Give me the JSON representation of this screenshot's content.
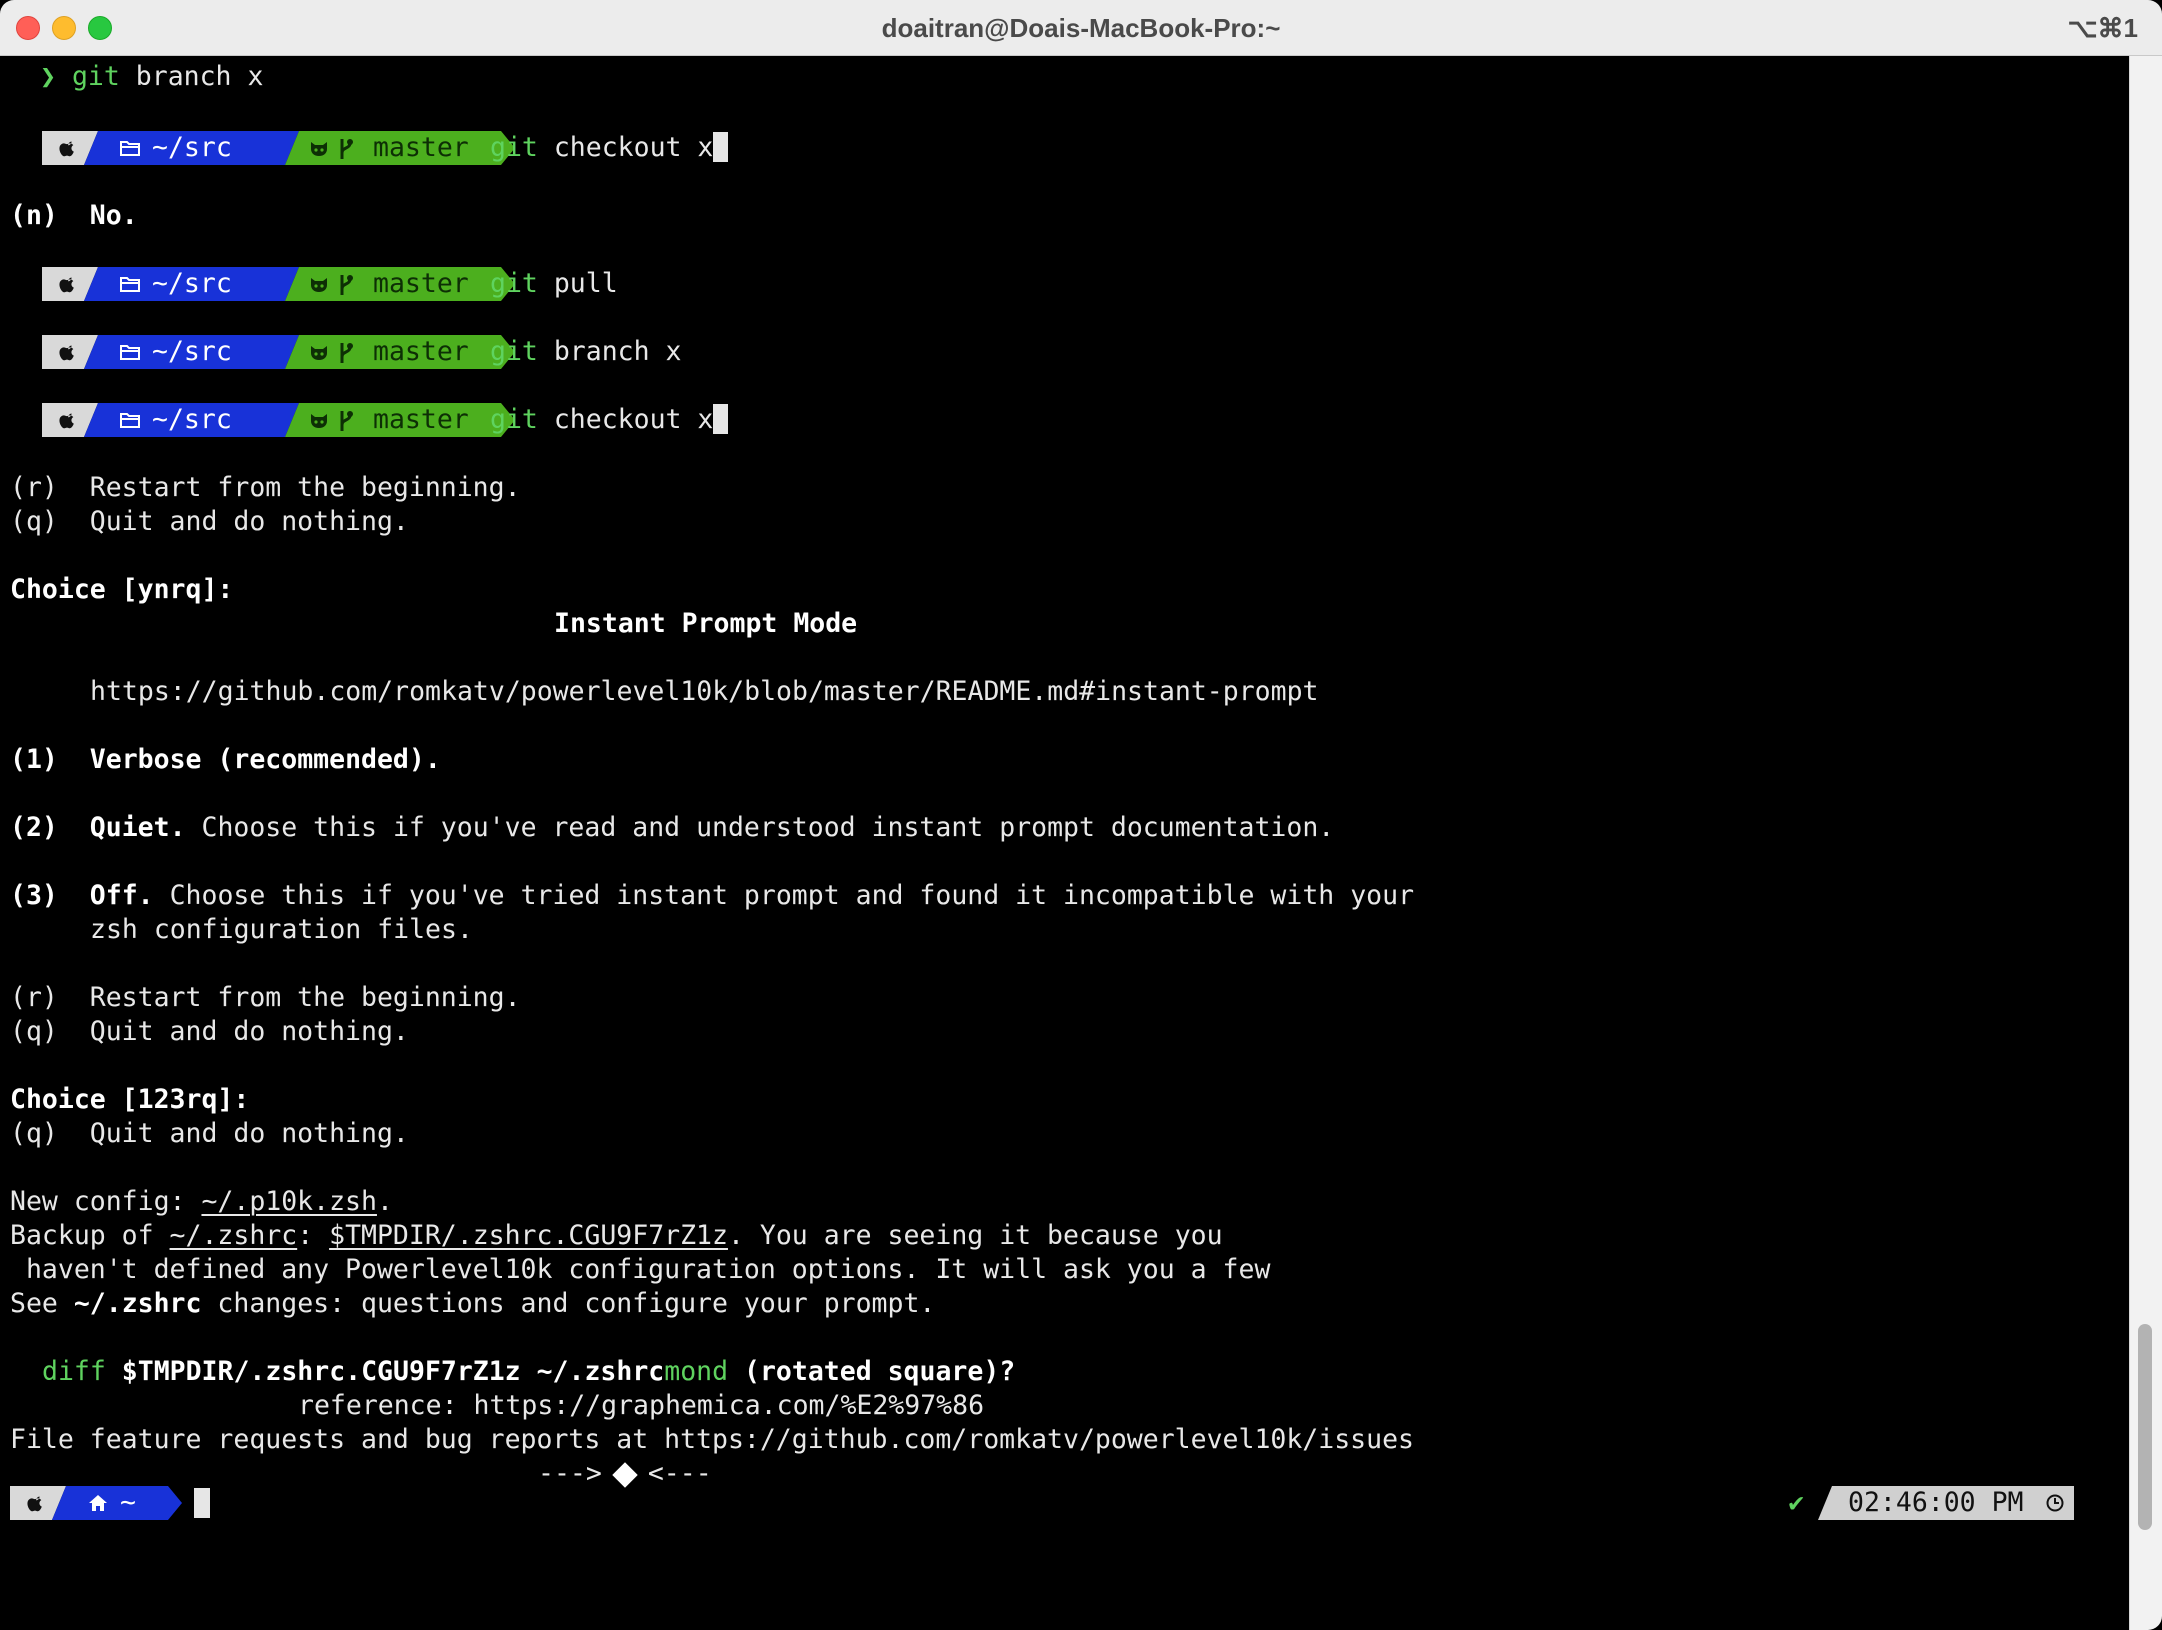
{
  "window": {
    "title": "doaitran@Doais-MacBook-Pro:~",
    "shortcut": "⌥⌘1"
  },
  "top_line": {
    "arrow": "❯",
    "git": "git",
    "rest": "branch x"
  },
  "prompt_segments": {
    "dir": "~/src",
    "branch": "master"
  },
  "prompts": [
    {
      "git": "git",
      "rest": "checkout x",
      "cursor": true
    },
    {
      "git": "git",
      "rest": "pull",
      "cursor": false
    },
    {
      "git": "git",
      "rest": "branch x",
      "cursor": false
    },
    {
      "git": "git",
      "rest": "checkout x",
      "cursor": true
    }
  ],
  "lines": {
    "n_key": "(n)",
    "n_text": "No.",
    "r1": "(r)  Restart from the beginning.",
    "q1": "(q)  Quit and do nothing.",
    "choice1": "Choice [ynrq]:",
    "mode_title": "Instant Prompt Mode",
    "url": "https://github.com/romkatv/powerlevel10k/blob/master/README.md#instant-prompt",
    "opt1_key": "(1)",
    "opt1_text": "Verbose (recommended).",
    "opt2_key": "(2)",
    "opt2_bold": "Quiet.",
    "opt2_text": " Choose this if you've read and understood instant prompt documentation.",
    "opt3_key": "(3)",
    "opt3_bold": "Off.",
    "opt3_text": " Choose this if you've tried instant prompt and found it incompatible with your",
    "opt3_cont": "zsh configuration files.",
    "r2": "(r)  Restart from the beginning.",
    "q2": "(q)  Quit and do nothing.",
    "choice2": "Choice [123rq]:",
    "q3": "(q)  Quit and do nothing.",
    "newconfig_label": "New config: ",
    "newconfig_file": "~/.p10k.zsh",
    "backup_label": "Backup of ",
    "backup_src": "~/.zshrc",
    "backup_sep": ": ",
    "backup_dst": "$TMPDIR/.zshrc.CGU9F7rZ1z",
    "backup_rest": ". You are seeing it because you",
    "havent": " haven't defined any Powerlevel10k configuration options. It will ask you a few",
    "see_label": "See ",
    "see_file": "~/.zshrc",
    "see_rest": " changes: questions and configure your prompt.",
    "diff_cmd": "diff",
    "diff_args": " $TMPDIR/.zshrc.CGU9F7rZ1z ~/.zshrc",
    "diff_mond": "mond",
    "diff_tail": " (rotated square)?",
    "reference": "reference: https://graphemica.com/%E2%97%86",
    "file_feature": "File feature requests and bug reports at https://github.com/romkatv/powerlevel10k/issues",
    "arrow_left": "--->",
    "arrow_right": "<---"
  },
  "bottom_prompt": {
    "dir": "~"
  },
  "right_prompt": {
    "check": "✔",
    "time": "02:46:00 PM"
  }
}
